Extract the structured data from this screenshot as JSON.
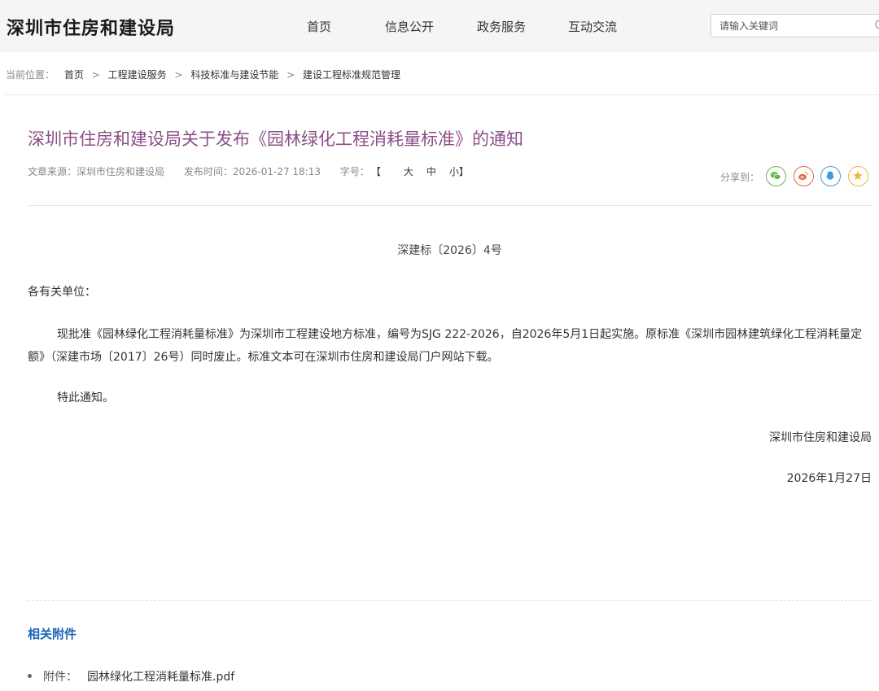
{
  "header": {
    "site_title": "深圳市住房和建设局",
    "nav": [
      "首页",
      "信息公开",
      "政务服务",
      "互动交流"
    ],
    "search_placeholder": "请输入关键词"
  },
  "breadcrumb": {
    "prefix": "当前位置：",
    "items": [
      "首页",
      "工程建设服务",
      "科技标准与建设节能",
      "建设工程标准规范管理"
    ],
    "separator": ">"
  },
  "article": {
    "title": "深圳市住房和建设局关于发布《园林绿化工程消耗量标准》的通知",
    "source": "文章来源：深圳市住房和建设局",
    "published": "发布时间：2026-01-27 18:13",
    "font_size_label": "字号：",
    "font_sizes": [
      "大",
      "中",
      "小"
    ],
    "bracket_open": "【",
    "bracket_close": "】",
    "share_label": "分享到：",
    "doc_number": "深建标〔2026〕4号",
    "salutation": "各有关单位：",
    "body": "现批准《园林绿化工程消耗量标准》为深圳市工程建设地方标准，编号为SJG 222-2026，自2026年5月1日起实施。原标准《深圳市园林建筑绿化工程消耗量定额》（深建市场〔2017〕26号）同时废止。标准文本可在深圳市住房和建设局门户网站下载。",
    "closing": "特此通知。",
    "signer": "深圳市住房和建设局",
    "date": "2026年1月27日"
  },
  "attachments": {
    "heading": "相关附件",
    "prefix": "附件：",
    "items": [
      "园林绿化工程消耗量标准.pdf"
    ]
  },
  "colors": {
    "title": "#8a4f86",
    "attach_heading": "#1d63b5",
    "wechat": "#5fba4b",
    "weibo": "#e4683f",
    "qq": "#3d9be0",
    "favorite": "#f3b43b"
  }
}
